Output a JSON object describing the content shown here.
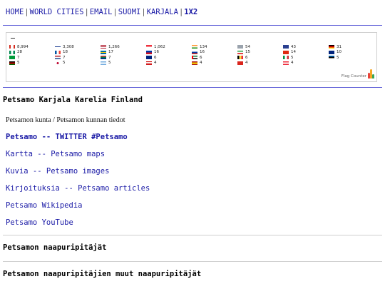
{
  "nav": {
    "items": [
      "HOME",
      "WORLD CITIES",
      "EMAIL",
      "SUOMI",
      "KARJALA",
      "1X2"
    ],
    "separator": "|"
  },
  "flag_counter": {
    "dash": "–",
    "rows": [
      [
        {
          "flag": "ca",
          "count": "8,994"
        },
        {
          "flag": "fi",
          "count": "3,308"
        },
        {
          "flag": "us",
          "count": "1,266"
        },
        {
          "flag": "sg",
          "count": "1,062"
        },
        {
          "flag": "in",
          "count": "134"
        },
        {
          "flag": "xx",
          "count": "54"
        },
        {
          "flag": "gb",
          "count": "43"
        },
        {
          "flag": "de",
          "count": "31"
        }
      ],
      [
        {
          "flag": "ng",
          "count": "28"
        },
        {
          "flag": "fr",
          "count": "18"
        },
        {
          "flag": "se",
          "count": "17"
        },
        {
          "flag": "ph",
          "count": "16"
        },
        {
          "flag": "ru",
          "count": "16"
        },
        {
          "flag": "ir",
          "count": "15"
        },
        {
          "flag": "cn",
          "count": "14"
        },
        {
          "flag": "au",
          "count": "10"
        }
      ],
      [
        {
          "flag": "br",
          "count": "7"
        },
        {
          "flag": "nl",
          "count": "7"
        },
        {
          "flag": "za",
          "count": "7"
        },
        {
          "flag": "au2",
          "count": "6"
        },
        {
          "flag": "ae",
          "count": "6"
        },
        {
          "flag": "be",
          "count": "6"
        },
        {
          "flag": "it",
          "count": "5"
        },
        {
          "flag": "ee",
          "count": "5"
        }
      ],
      [
        {
          "flag": "ke",
          "count": "5"
        },
        {
          "flag": "jp",
          "count": "5"
        },
        {
          "flag": "ar",
          "count": "5"
        },
        {
          "flag": "my",
          "count": "4"
        },
        {
          "flag": "es",
          "count": "4"
        },
        {
          "flag": "vn",
          "count": "4"
        },
        {
          "flag": "at",
          "count": "4"
        }
      ]
    ],
    "brand": "Flag Counter"
  },
  "title": "Petsamo Karjala Karelia Finland",
  "subtitle": "Petsamon kunta / Petsamon kunnan tiedot",
  "links": [
    {
      "label": "Petsamo -- TWITTER #Petsamo",
      "bold": true
    },
    {
      "label": "Kartta -- Petsamo maps",
      "bold": false
    },
    {
      "label": "Kuvia -- Petsamo images",
      "bold": false
    },
    {
      "label": "Kirjoituksia -- Petsamo articles",
      "bold": false
    },
    {
      "label": "Petsamo Wikipedia",
      "bold": false
    },
    {
      "label": "Petsamo YouTube",
      "bold": false
    }
  ],
  "sections": {
    "neighbors": "Petsamon naapuripitäjät",
    "neighbors_of_neighbors": "Petsamon naapuripitäjien muut naapuripitäjät"
  },
  "colors": {
    "link": "#1a1aa6",
    "rule": "#5a5ad6"
  }
}
